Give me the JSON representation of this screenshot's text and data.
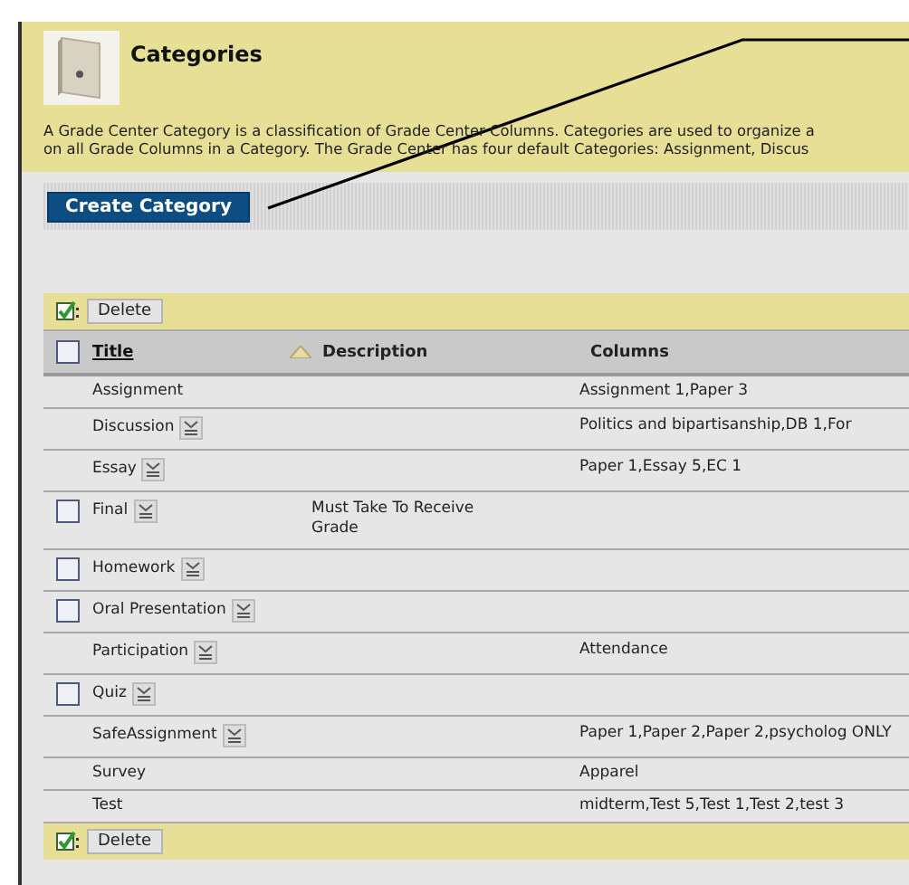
{
  "header": {
    "title": "Categories",
    "description": [
      "A Grade Center Category is a classification of Grade Center Columns. Categories are used to organize a",
      "on all Grade Columns in a Category. The Grade Center has four default Categories: Assignment, Discus"
    ]
  },
  "create_button": "Create Category",
  "delete_button_top": "Delete",
  "table": {
    "columns": [
      "Title",
      "Description",
      "Columns"
    ],
    "select_all_checked": false,
    "rows": [
      {
        "title": "Assignment",
        "description": "",
        "columns": "Assignment 1,Paper 3",
        "checkbox": false,
        "menu": false
      },
      {
        "title": "Discussion",
        "description": "",
        "columns": "Politics and bipartisanship,DB 1,For",
        "checkbox": false,
        "menu": true
      },
      {
        "title": "Essay",
        "description": "",
        "columns": "Paper 1,Essay 5,EC 1",
        "checkbox": false,
        "menu": true
      },
      {
        "title": "Final",
        "description": "Must Take To Receive Grade",
        "columns": "",
        "checkbox": true,
        "menu": true
      },
      {
        "title": "Homework",
        "description": "",
        "columns": "",
        "checkbox": true,
        "menu": true
      },
      {
        "title": "Oral Presentation",
        "description": "",
        "columns": "",
        "checkbox": true,
        "menu": true
      },
      {
        "title": "Participation",
        "description": "",
        "columns": "Attendance",
        "checkbox": false,
        "menu": true
      },
      {
        "title": "Quiz",
        "description": "",
        "columns": "",
        "checkbox": true,
        "menu": true
      },
      {
        "title": "SafeAssignment",
        "description": "",
        "columns": "Paper 1,Paper 2,Paper 2,psycholog ONLY",
        "checkbox": false,
        "menu": true
      },
      {
        "title": "Survey",
        "description": "",
        "columns": "Apparel",
        "checkbox": false,
        "menu": false
      },
      {
        "title": "Test",
        "description": "",
        "columns": "midterm,Test 5,Test 1,Test 2,test 3",
        "checkbox": false,
        "menu": false
      }
    ]
  },
  "delete_button_bottom": "Delete"
}
